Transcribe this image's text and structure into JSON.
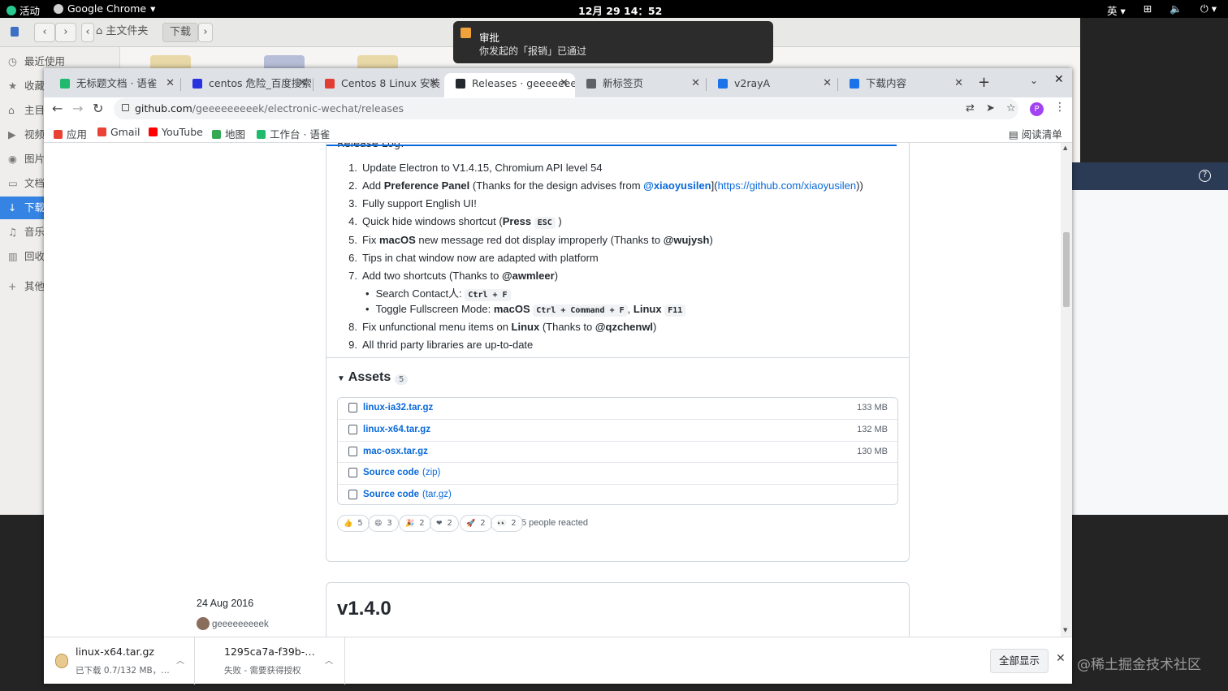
{
  "topbar": {
    "activities": "活动",
    "app_name": "Google Chrome",
    "clock": "12月 29  14：52",
    "input_method": "英"
  },
  "nautilus": {
    "path_home": "主文件夹",
    "path_current": "下载",
    "sidebar": [
      {
        "icon": "clock-icon",
        "label": "最近使用"
      },
      {
        "icon": "star-icon",
        "label": "收藏"
      },
      {
        "icon": "home-icon",
        "label": "主目"
      },
      {
        "icon": "video-icon",
        "label": "视频"
      },
      {
        "icon": "camera-icon",
        "label": "图片"
      },
      {
        "icon": "document-icon",
        "label": "文档"
      },
      {
        "icon": "download-icon",
        "label": "下载"
      },
      {
        "icon": "music-icon",
        "label": "音乐"
      },
      {
        "icon": "trash-icon",
        "label": "回收"
      },
      {
        "icon": "plus-icon",
        "label": "其他"
      }
    ]
  },
  "notification": {
    "title": "审批",
    "body": "你发起的「报销」已通过"
  },
  "watermark": "@稀土掘金技术社区",
  "chrome": {
    "tabs": [
      {
        "title": "无标题文档 · 语雀",
        "favicon_color": "#1fba6e",
        "icon": "yuque-icon"
      },
      {
        "title": "centos 危险_百度搜索",
        "favicon_color": "#2932e1",
        "icon": "baidu-icon"
      },
      {
        "title": "Centos 8 Linux 安装",
        "favicon_color": "#e33e33",
        "icon": "csdn-icon"
      },
      {
        "title": "Releases · geeeeeeeek",
        "favicon_color": "#24292f",
        "icon": "github-icon"
      },
      {
        "title": "新标签页",
        "favicon_color": "#5f6368",
        "icon": "chrome-icon"
      },
      {
        "title": "v2rayA",
        "favicon_color": "#1a73e8",
        "icon": "v2raya-icon"
      },
      {
        "title": "下载内容",
        "favicon_color": "#1a73e8",
        "icon": "download-icon"
      }
    ],
    "url_host": "github.com",
    "url_path": "/geeeeeeeeek/electronic-wechat/releases",
    "profile_initial": "P",
    "bookmarks": [
      {
        "label": "应用",
        "color": "#e94235"
      },
      {
        "label": "Gmail",
        "color": "#ea4335"
      },
      {
        "label": "YouTube",
        "color": "#ff0000"
      },
      {
        "label": "地图",
        "color": "#34a853"
      },
      {
        "label": "工作台 · 语雀",
        "color": "#1fba6e"
      }
    ],
    "reading_list": "阅读清单"
  },
  "release": {
    "release_log_label": "Release Log:",
    "items": [
      {
        "num": "1.",
        "html_parts": [
          "Update Electron to V1.4.15, Chromium API level 54"
        ]
      },
      {
        "num": "2.",
        "prefix": "Add ",
        "bold": "Preference Panel",
        "mid": " (Thanks for the design advises from ",
        "link_user": "@xiaoyusilen",
        "bracket": "](",
        "link_url": "https://github.com/xiaoyusilen",
        "suffix": "))"
      },
      {
        "num": "3.",
        "text": "Fully support English UI!"
      },
      {
        "num": "4.",
        "prefix": "Quick hide windows shortcut (",
        "bold": "Press",
        "code": "ESC",
        "suffix": " )"
      },
      {
        "num": "5.",
        "prefix": "Fix ",
        "bold": "macOS",
        "mid": " new message red dot display improperly (Thanks to ",
        "bold2": "@wujysh",
        "suffix": ")"
      },
      {
        "num": "6.",
        "text": "Tips in chat window now are adapted with platform"
      },
      {
        "num": "7.",
        "prefix": "Add two shortcuts (Thanks to ",
        "bold": "@awmleer",
        "suffix": ")"
      },
      {
        "num": "8.",
        "prefix": "Fix unfunctional menu items on ",
        "bold": "Linux",
        "mid": " (Thanks to ",
        "bold2": "@qzchenwl",
        "suffix": ")"
      },
      {
        "num": "9.",
        "text": "All thrid party libraries are up-to-date"
      }
    ],
    "sub1_label": "Search Contact人:",
    "sub1_code": "Ctrl + F",
    "sub2_label": "Toggle Fullscreen Mode:",
    "sub2_os1": "macOS",
    "sub2_code1": "Ctrl + Command + F",
    "sub2_sep": ",",
    "sub2_os2": "Linux",
    "sub2_code2": "F11",
    "assets_title": "Assets",
    "assets_count": "5",
    "assets": [
      {
        "name": "linux-ia32.tar.gz",
        "sub": "",
        "size": "133 MB",
        "icon": "package-icon"
      },
      {
        "name": "linux-x64.tar.gz",
        "sub": "",
        "size": "132 MB",
        "icon": "package-icon"
      },
      {
        "name": "mac-osx.tar.gz",
        "sub": "",
        "size": "130 MB",
        "icon": "package-icon"
      },
      {
        "name": "Source code",
        "sub": "(zip)",
        "size": "",
        "icon": "file-zip-icon"
      },
      {
        "name": "Source code",
        "sub": "(tar.gz)",
        "size": "",
        "icon": "file-zip-icon"
      }
    ],
    "reactions": [
      {
        "emoji": "👍",
        "count": "5",
        "name": "thumbs-up-icon"
      },
      {
        "emoji": "😄",
        "count": "3",
        "name": "laugh-icon"
      },
      {
        "emoji": "🎉",
        "count": "2",
        "name": "hooray-icon"
      },
      {
        "emoji": "❤",
        "count": "2",
        "name": "heart-icon"
      },
      {
        "emoji": "🚀",
        "count": "2",
        "name": "rocket-icon"
      },
      {
        "emoji": "👀",
        "count": "2",
        "name": "eyes-icon"
      }
    ],
    "reacted_text": "5 people reacted"
  },
  "next_release": {
    "date": "24 Aug 2016",
    "author": "geeeeeeeeek",
    "version": "v1.4.0"
  },
  "downloads": [
    {
      "name": "linux-x64.tar.gz",
      "status": "已下载 0.7/132 MB，…"
    },
    {
      "name": "1295ca7a-f39b-…",
      "status": "失败 - 需要获得授权"
    }
  ],
  "show_all": "全部显示"
}
